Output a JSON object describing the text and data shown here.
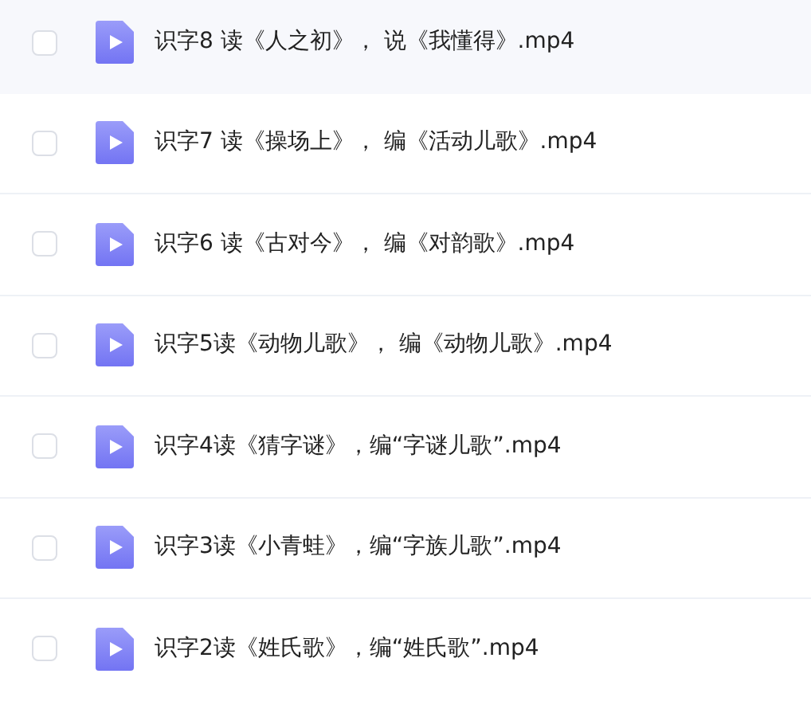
{
  "files": [
    {
      "name": "识字8 读《人之初》， 说《我懂得》.mp4",
      "checked": false,
      "highlighted": true
    },
    {
      "name": "识字7 读《操场上》， 编《活动儿歌》.mp4",
      "checked": false,
      "highlighted": false
    },
    {
      "name": "识字6 读《古对今》， 编《对韵歌》.mp4",
      "checked": false,
      "highlighted": false
    },
    {
      "name": "识字5读《动物儿歌》， 编《动物儿歌》.mp4",
      "checked": false,
      "highlighted": false
    },
    {
      "name": "识字4读《猜字谜》，编“字谜儿歌”.mp4",
      "checked": false,
      "highlighted": false
    },
    {
      "name": "识字3读《小青蛙》，编“字族儿歌”.mp4",
      "checked": false,
      "highlighted": false
    },
    {
      "name": "识字2读《姓氏歌》，编“姓氏歌”.mp4",
      "checked": false,
      "highlighted": false
    }
  ]
}
